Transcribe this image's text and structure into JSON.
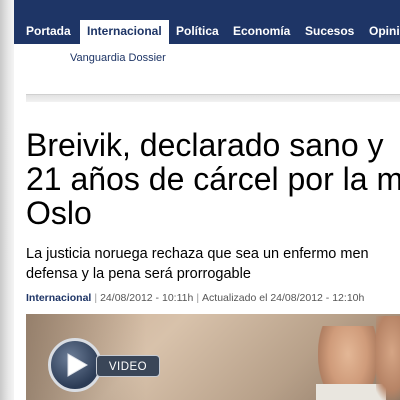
{
  "nav": {
    "items": [
      {
        "label": "Portada"
      },
      {
        "label": "Internacional"
      },
      {
        "label": "Política"
      },
      {
        "label": "Economía"
      },
      {
        "label": "Sucesos"
      },
      {
        "label": "Opini"
      }
    ],
    "active_index": 1
  },
  "subnav": {
    "label": "Vanguardia Dossier"
  },
  "article": {
    "headline_lines": [
      "Breivik, declarado sano y",
      "21 años de cárcel por la m",
      "Oslo"
    ],
    "summary_lines": [
      "La justicia noruega rechaza que sea un enfermo men",
      "defensa y la pena será prorrogable"
    ],
    "meta": {
      "section": "Internacional",
      "date": "24/08/2012 - 10:11h",
      "updated": "Actualizado el 24/08/2012 - 12:10h"
    }
  },
  "media": {
    "video_label": "VIDEO",
    "play_icon": "play-icon"
  },
  "colors": {
    "nav_bg": "#1e3566",
    "nav_text": "#ffffff",
    "accent": "#1e3566"
  }
}
